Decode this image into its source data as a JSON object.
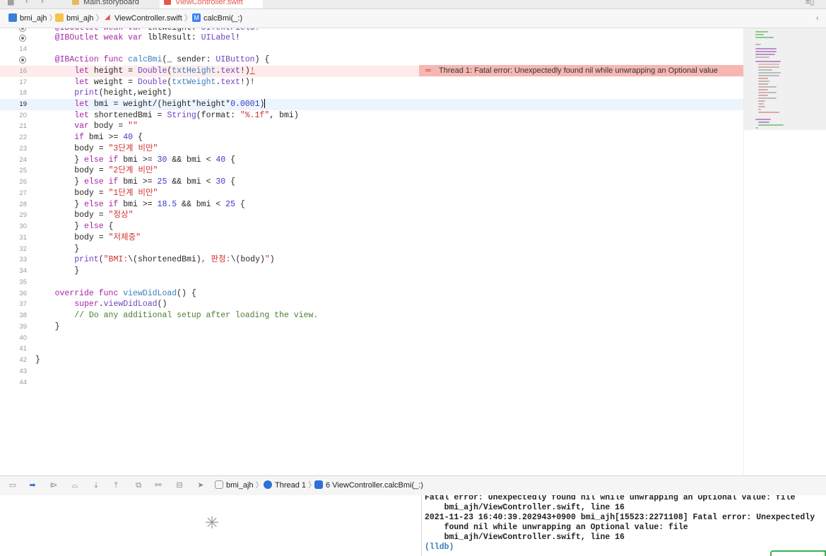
{
  "tabs": [
    {
      "label": "Main.storyboard",
      "icon": "storyboard-icon",
      "active": false
    },
    {
      "label": "ViewController.swift",
      "icon": "swift-file-icon",
      "active": true
    }
  ],
  "jumpbar": {
    "crumbs": [
      {
        "label": "bmi_ajh",
        "icon": "project-icon"
      },
      {
        "label": "bmi_ajh",
        "icon": "folder-icon"
      },
      {
        "label": "ViewController.swift",
        "icon": "swift-file-icon"
      },
      {
        "label": "calcBmi(_:)",
        "icon": "method-icon",
        "badge": "M"
      }
    ]
  },
  "editor": {
    "error_banner": "Thread 1: Fatal error: Unexpectedly found nil while unwrapping an Optional value",
    "current_line": 19,
    "error_line": 16
  },
  "debugbar": {
    "crumbs": [
      {
        "label": "bmi_ajh",
        "icon": "process-icon"
      },
      {
        "label": "Thread 1",
        "icon": "thread-icon"
      },
      {
        "label": "6 ViewController.calcBmi(_:)",
        "icon": "frame-icon"
      }
    ]
  },
  "console": {
    "lines": [
      "Fatal error: Unexpectedly found nil while unwrapping an Optional value: file",
      "    bmi_ajh/ViewController.swift, line 16",
      "2021-11-23 16:40:39.202943+0900 bmi_ajh[15523:2271108] Fatal error: Unexpectedly",
      "    found nil while unwrapping an Optional value: file",
      "    bmi_ajh/ViewController.swift, line 16"
    ],
    "prompt": "(lldb)"
  },
  "colors": {
    "error_bg": "#f6b7b3",
    "error_line_bg": "#fdeceb",
    "current_line_bg": "#ecf4fd",
    "keyword": "#a626a4",
    "string": "#d0322f"
  }
}
